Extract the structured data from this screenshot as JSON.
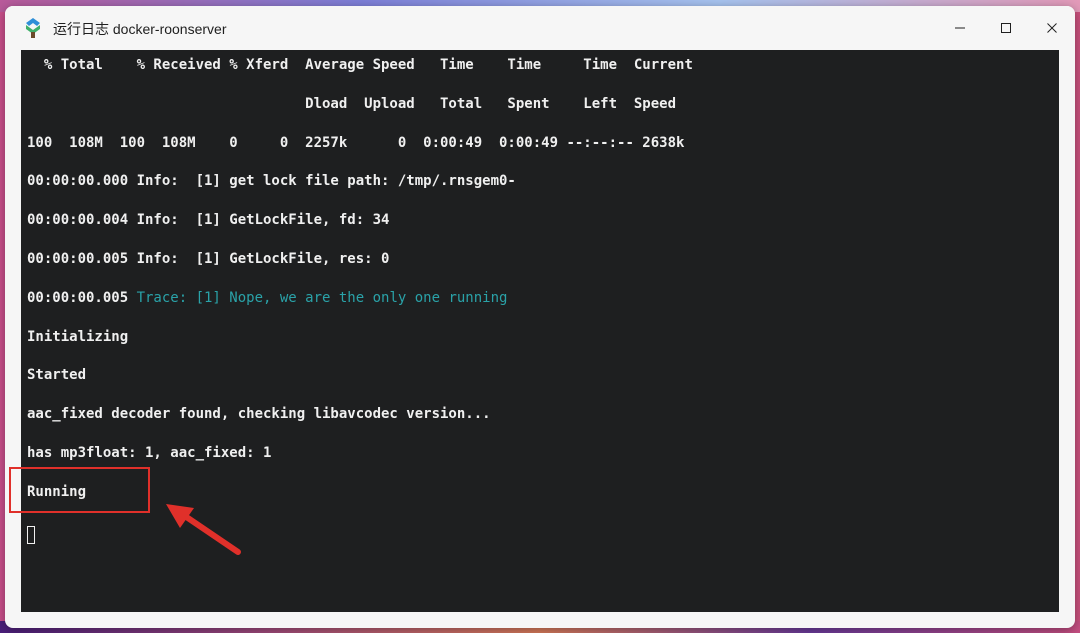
{
  "window": {
    "title": "运行日志 docker-roonserver"
  },
  "terminal": {
    "lines": [
      "  % Total    % Received % Xferd  Average Speed   Time    Time     Time  Current",
      "                                 Dload  Upload   Total   Spent    Left  Speed",
      "100  108M  100  108M    0     0  2257k      0  0:00:49  0:00:49 --:--:-- 2638k",
      "00:00:00.000 Info:  [1] get lock file path: /tmp/.rnsgem0-",
      "00:00:00.004 Info:  [1] GetLockFile, fd: 34",
      "00:00:00.005 Info:  [1] GetLockFile, res: 0",
      "",
      "Initializing",
      "Started",
      "aac_fixed decoder found, checking libavcodec version...",
      "has mp3float: 1, aac_fixed: 1",
      "Running"
    ],
    "trace_line": {
      "timestamp": "00:00:00.005 ",
      "message": "Trace: [1] Nope, we are the only one running"
    }
  },
  "colors": {
    "terminal_bg": "#1e1f20",
    "terminal_fg": "#f0f0f0",
    "trace": "#2aa2a8",
    "annotation_red": "#e0302a"
  },
  "icons": {
    "app": "roon-docker-icon",
    "minimize": "minimize-icon",
    "maximize": "maximize-icon",
    "close": "close-icon"
  }
}
